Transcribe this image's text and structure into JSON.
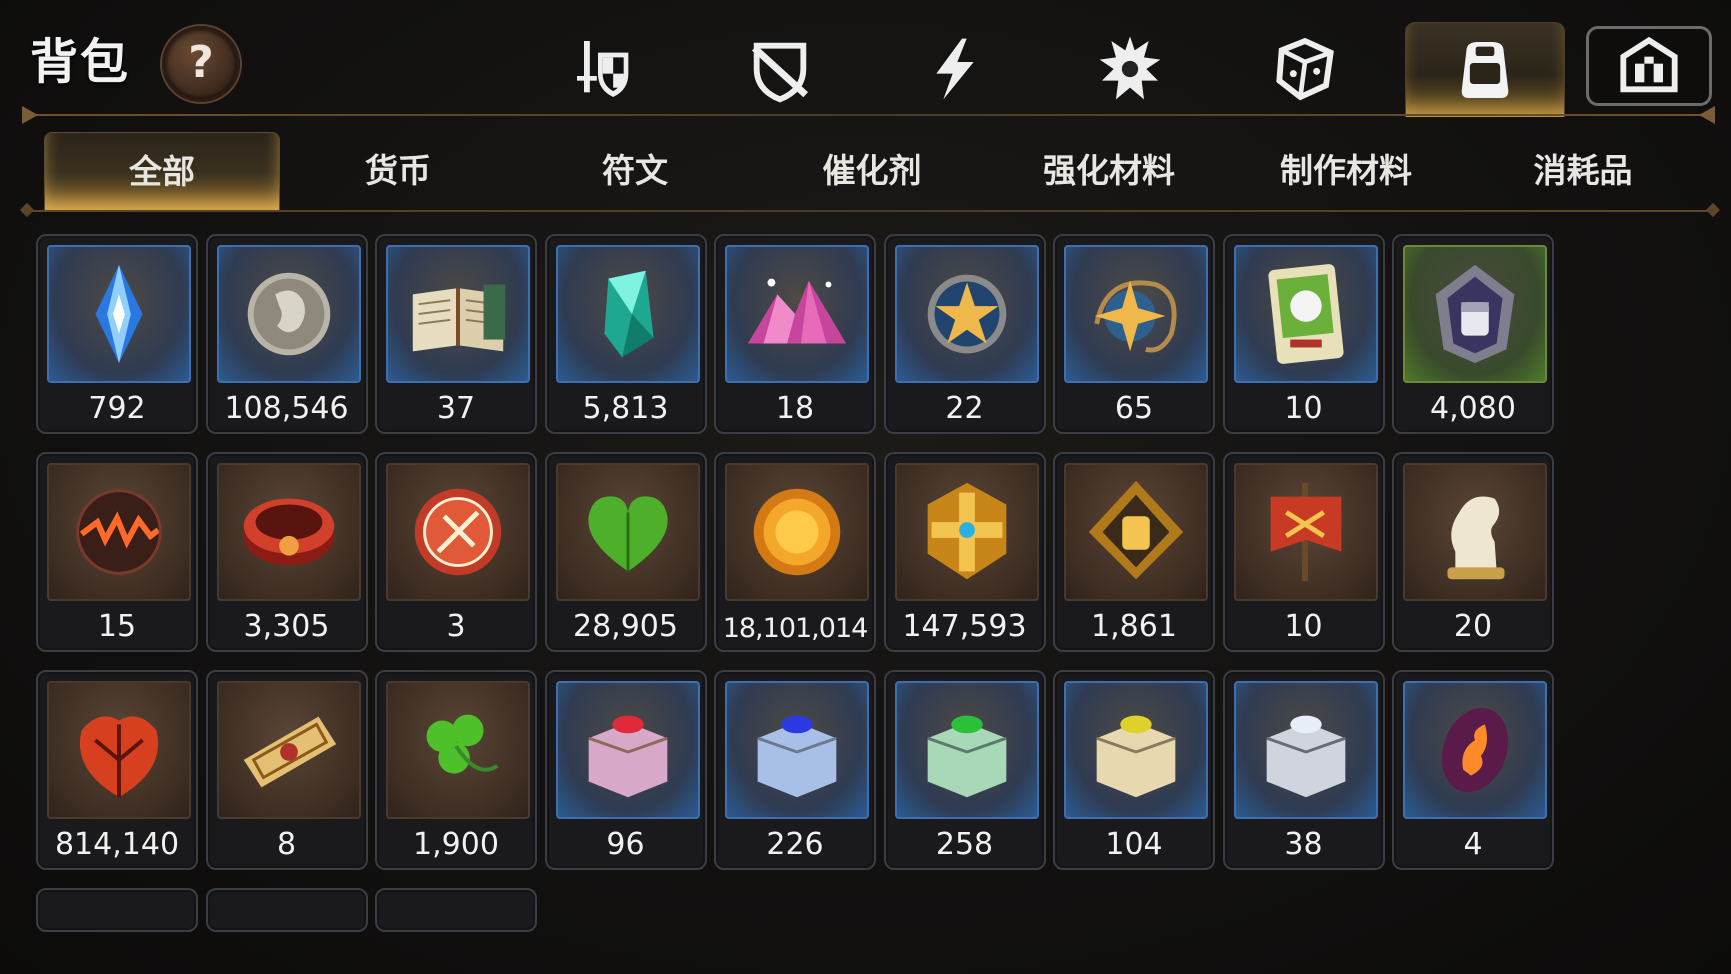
{
  "header": {
    "title": "背包",
    "help_label": "?",
    "top_tabs": [
      {
        "icon": "sword-shield-icon",
        "active": false
      },
      {
        "icon": "shield-slash-icon",
        "active": false
      },
      {
        "icon": "lightning-icon",
        "active": false
      },
      {
        "icon": "spiky-emblem-icon",
        "active": false
      },
      {
        "icon": "dice-icon",
        "active": false
      },
      {
        "icon": "backpack-icon",
        "active": true
      },
      {
        "icon": "castle-icon",
        "active": false
      }
    ]
  },
  "category_tabs": [
    {
      "label": "全部",
      "active": true
    },
    {
      "label": "货币",
      "active": false
    },
    {
      "label": "符文",
      "active": false
    },
    {
      "label": "催化剂",
      "active": false
    },
    {
      "label": "强化材料",
      "active": false
    },
    {
      "label": "制作材料",
      "active": false
    },
    {
      "label": "消耗品",
      "active": false
    }
  ],
  "items": [
    {
      "icon": "blue-crystal-icon",
      "count": "792",
      "frame": "blue"
    },
    {
      "icon": "silver-coin-icon",
      "count": "108,546",
      "frame": "blue"
    },
    {
      "icon": "book-icon",
      "count": "37",
      "frame": "blue"
    },
    {
      "icon": "teal-crystal-icon",
      "count": "5,813",
      "frame": "blue"
    },
    {
      "icon": "pink-ore-icon",
      "count": "18",
      "frame": "blue"
    },
    {
      "icon": "star-medallion-icon",
      "count": "22",
      "frame": "blue"
    },
    {
      "icon": "star-amulet-icon",
      "count": "65",
      "frame": "blue"
    },
    {
      "icon": "green-card-icon",
      "count": "10",
      "frame": "blue"
    },
    {
      "icon": "fist-emblem-icon",
      "count": "4,080",
      "frame": "green"
    },
    {
      "icon": "lava-orb-icon",
      "count": "15",
      "frame": "brown"
    },
    {
      "icon": "red-ring-icon",
      "count": "3,305",
      "frame": "brown"
    },
    {
      "icon": "red-seal-icon",
      "count": "3",
      "frame": "brown"
    },
    {
      "icon": "green-heart-icon",
      "count": "28,905",
      "frame": "brown"
    },
    {
      "icon": "sun-coin-icon",
      "count": "18,101,014",
      "frame": "brown"
    },
    {
      "icon": "gold-cross-emblem-icon",
      "count": "147,593",
      "frame": "brown"
    },
    {
      "icon": "gold-fist-badge-icon",
      "count": "1,861",
      "frame": "brown"
    },
    {
      "icon": "red-banner-icon",
      "count": "10",
      "frame": "brown"
    },
    {
      "icon": "knight-chess-icon",
      "count": "20",
      "frame": "brown"
    },
    {
      "icon": "red-leaf-icon",
      "count": "814,140",
      "frame": "brown"
    },
    {
      "icon": "golden-ticket-icon",
      "count": "8",
      "frame": "brown"
    },
    {
      "icon": "clover-icon",
      "count": "1,900",
      "frame": "brown"
    },
    {
      "icon": "pink-gem-chest-icon",
      "count": "96",
      "frame": "blue"
    },
    {
      "icon": "blue-gem-chest-icon",
      "count": "226",
      "frame": "blue"
    },
    {
      "icon": "green-gem-chest-icon",
      "count": "258",
      "frame": "blue"
    },
    {
      "icon": "gold-gem-chest-icon",
      "count": "104",
      "frame": "blue"
    },
    {
      "icon": "silver-gem-chest-icon",
      "count": "38",
      "frame": "blue"
    },
    {
      "icon": "fire-stone-icon",
      "count": "4",
      "frame": "blue"
    }
  ],
  "colors": {
    "accent_gold": "#d6a648",
    "frame_blue": "#3f6fb0",
    "frame_brown": "#4a3a2e",
    "frame_green": "#6a8a3a"
  }
}
